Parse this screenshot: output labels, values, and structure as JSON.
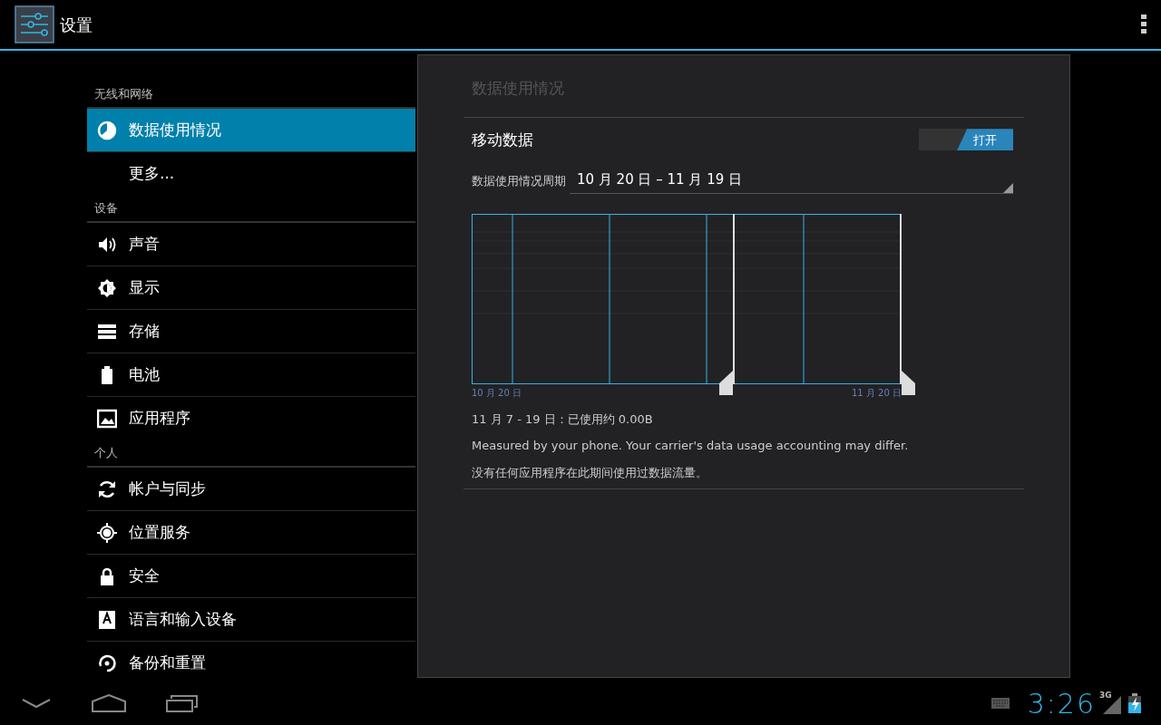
{
  "action_bar": {
    "title": "设置"
  },
  "sidebar": {
    "sections": [
      {
        "header": "无线和网络",
        "items": [
          {
            "label": "数据使用情况",
            "selected": true,
            "kind": "icon"
          },
          {
            "label": "更多...",
            "selected": false,
            "kind": "plain"
          }
        ]
      },
      {
        "header": "设备",
        "items": [
          {
            "label": "声音",
            "selected": false,
            "kind": "icon"
          },
          {
            "label": "显示",
            "selected": false,
            "kind": "icon"
          },
          {
            "label": "存储",
            "selected": false,
            "kind": "icon"
          },
          {
            "label": "电池",
            "selected": false,
            "kind": "icon"
          },
          {
            "label": "应用程序",
            "selected": false,
            "kind": "icon"
          }
        ]
      },
      {
        "header": "个人",
        "items": [
          {
            "label": "帐户与同步",
            "selected": false,
            "kind": "icon"
          },
          {
            "label": "位置服务",
            "selected": false,
            "kind": "icon"
          },
          {
            "label": "安全",
            "selected": false,
            "kind": "icon"
          },
          {
            "label": "语言和输入设备",
            "selected": false,
            "kind": "icon"
          },
          {
            "label": "备份和重置",
            "selected": false,
            "kind": "icon"
          }
        ]
      }
    ]
  },
  "detail": {
    "title": "数据使用情况",
    "mobile_data": {
      "label": "移动数据",
      "on": true,
      "toggle_label": "打开"
    },
    "cycle": {
      "label": "数据使用情况周期",
      "value": "10 月 20 日 – 11 月 19 日"
    },
    "chart": {
      "start_label": "10 月 20 日",
      "end_label": "11 月 20 日"
    },
    "summary": "11 月 7 - 19 日：已使用约 0.00B",
    "note": "Measured by your phone. Your carrier's data usage accounting may differ.",
    "empty": "没有任何应用程序在此期间使用过数据流量。"
  },
  "status_bar": {
    "time": "3:26",
    "network": "3G"
  }
}
